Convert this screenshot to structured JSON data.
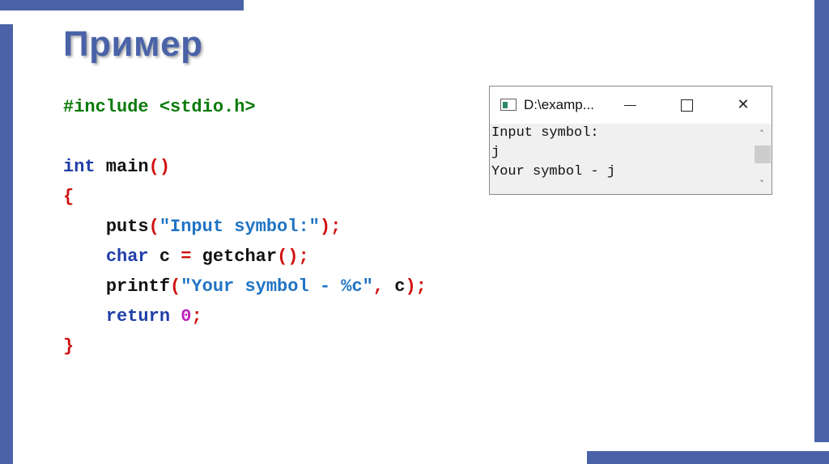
{
  "slide": {
    "title": "Пример"
  },
  "code": {
    "include": "#include <stdio.h>",
    "main_type": "int",
    "main_name": " main",
    "main_parens": "()",
    "open_brace": "{",
    "puts_fn": "puts",
    "puts_paren_open": "(",
    "puts_str": "\"Input symbol:\"",
    "puts_close": ");",
    "char_kw": "char",
    "char_var": " c ",
    "char_eq": "=",
    "char_call": " getchar",
    "char_close": "();",
    "printf_fn": "printf",
    "printf_paren_open": "(",
    "printf_str": "\"Your symbol - %c\"",
    "printf_comma": ",",
    "printf_arg": " c",
    "printf_close": ");",
    "return_kw": "return",
    "return_val": "0",
    "return_semi": ";",
    "close_brace": "}"
  },
  "console": {
    "title": "D:\\examp...",
    "lines": [
      "Input symbol:",
      "j",
      "Your symbol - j"
    ],
    "icons": {
      "minimize": "minimize-icon",
      "maximize": "maximize-icon",
      "close": "close-icon",
      "close_glyph": "✕",
      "scroll_up_glyph": "˄",
      "scroll_down_glyph": "˅"
    }
  },
  "colors": {
    "accent": "#4a63a8",
    "preprocessor": "#0a7a0a",
    "keyword": "#1f3ea8",
    "string": "#1f73c4",
    "operator": "#d01010",
    "number": "#c020c0"
  }
}
